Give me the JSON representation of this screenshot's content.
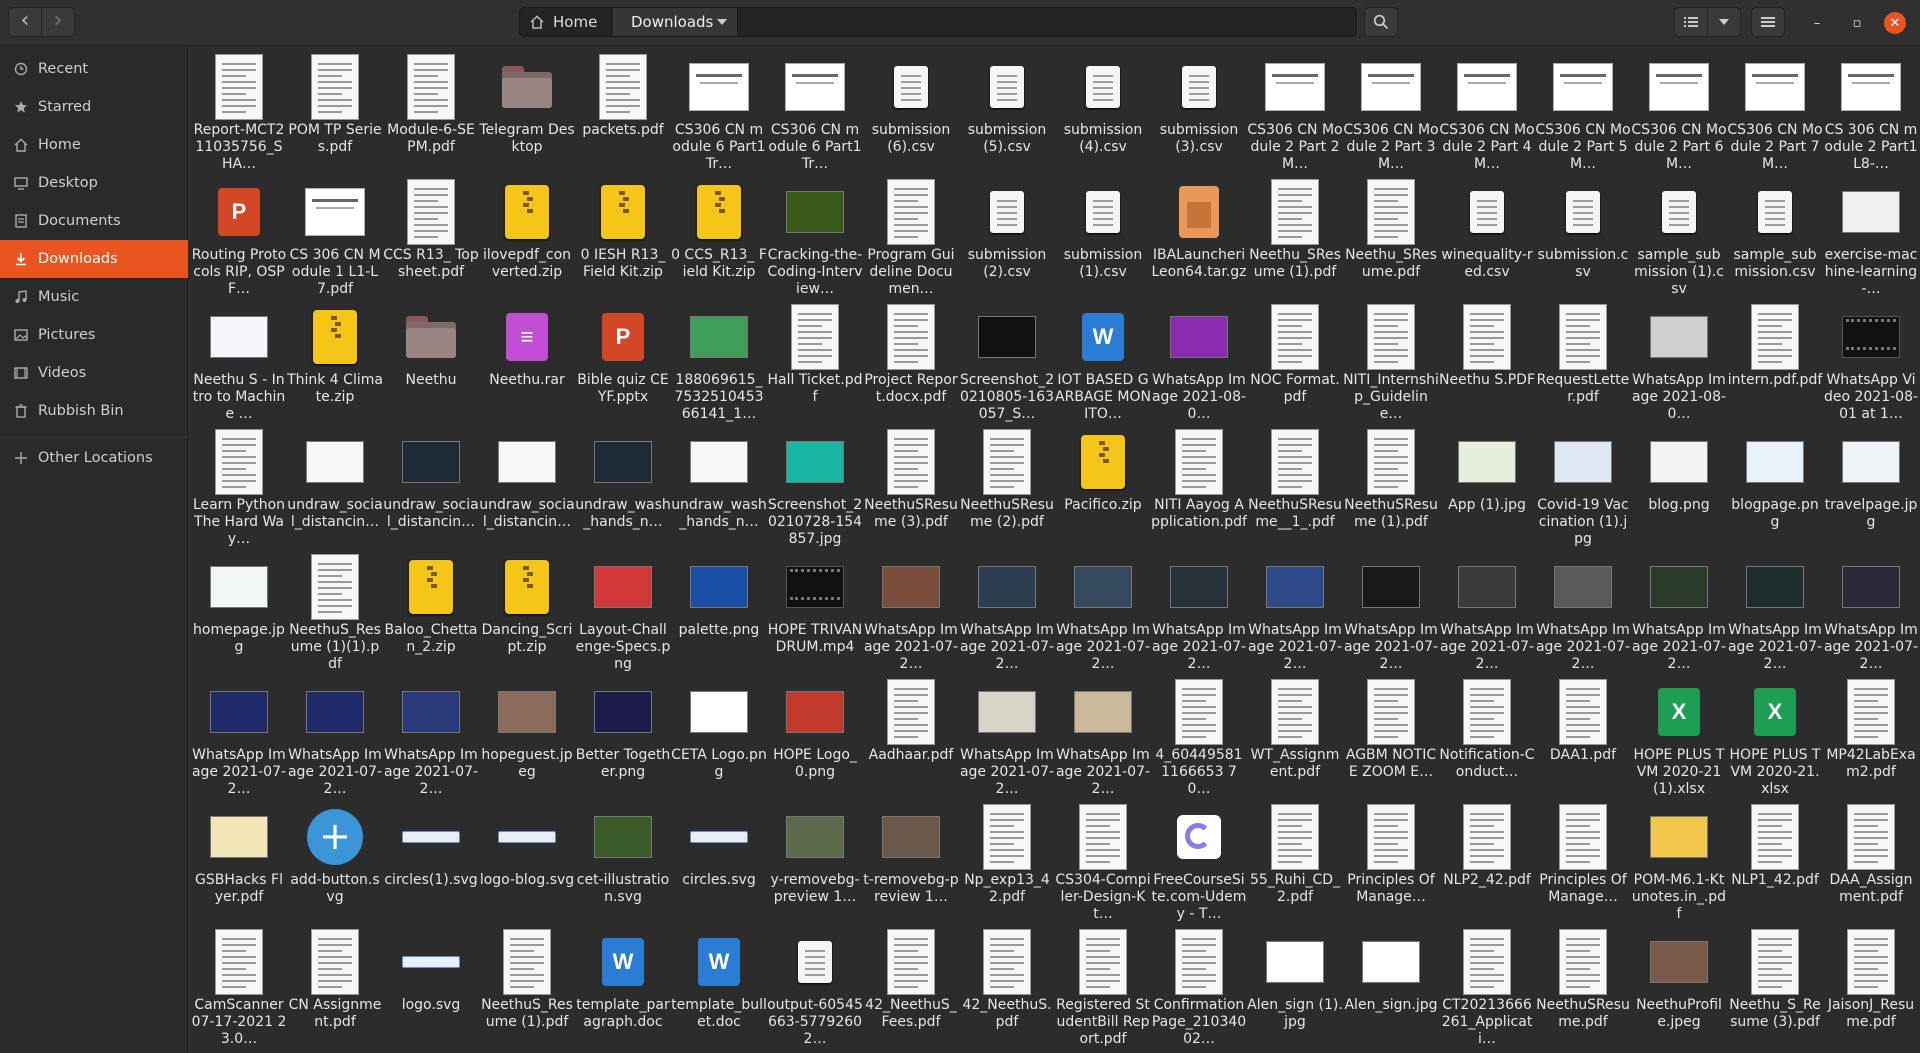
{
  "header": {
    "back_icon": "chevron-left-icon",
    "forward_icon": "chevron-right-icon",
    "crumb_home": "Home",
    "crumb_current": "Downloads",
    "search_icon": "search-icon",
    "view_icon": "list-view-icon",
    "menu_icon": "hamburger-menu-icon",
    "window_controls": [
      "minimize-icon",
      "maximize-icon",
      "close-icon"
    ],
    "accent_color": "#e95420"
  },
  "sidebar": {
    "items": [
      {
        "label": "Recent",
        "icon": "clock-icon",
        "active": false
      },
      {
        "label": "Starred",
        "icon": "star-icon",
        "active": false
      },
      {
        "label": "Home",
        "icon": "home-icon",
        "active": false
      },
      {
        "label": "Desktop",
        "icon": "desktop-icon",
        "active": false
      },
      {
        "label": "Documents",
        "icon": "documents-icon",
        "active": false
      },
      {
        "label": "Downloads",
        "icon": "download-icon",
        "active": true
      },
      {
        "label": "Music",
        "icon": "music-icon",
        "active": false
      },
      {
        "label": "Pictures",
        "icon": "pictures-icon",
        "active": false
      },
      {
        "label": "Videos",
        "icon": "videos-icon",
        "active": false
      },
      {
        "label": "Rubbish Bin",
        "icon": "trash-icon",
        "active": false
      },
      {
        "label": "Other Locations",
        "icon": "plus-icon",
        "active": false
      }
    ]
  },
  "files": [
    {
      "name": "Report-MCT211035756_SHA…",
      "kind": "doc"
    },
    {
      "name": "POM TP Series.pdf",
      "kind": "doc"
    },
    {
      "name": "Module-6-SEPM.pdf",
      "kind": "doc"
    },
    {
      "name": "Telegram Desktop",
      "kind": "folder"
    },
    {
      "name": "packets.pdf",
      "kind": "doc"
    },
    {
      "name": "CS306 CN module 6 Part1 Tr…",
      "kind": "slide"
    },
    {
      "name": "CS306 CN module 6 Part1 Tr…",
      "kind": "slide"
    },
    {
      "name": "submission (6).csv",
      "kind": "gen"
    },
    {
      "name": "submission (5).csv",
      "kind": "gen"
    },
    {
      "name": "submission (4).csv",
      "kind": "gen"
    },
    {
      "name": "submission (3).csv",
      "kind": "gen"
    },
    {
      "name": "CS306 CN Module 2 Part 2 M…",
      "kind": "slide"
    },
    {
      "name": "CS306 CN Module 2 Part 3 M…",
      "kind": "slide"
    },
    {
      "name": "CS306 CN Module 2 Part 4 M…",
      "kind": "slide"
    },
    {
      "name": "CS306 CN Module 2 Part 5 M…",
      "kind": "slide"
    },
    {
      "name": "CS306 CN Module 2 Part 6 M…",
      "kind": "slide"
    },
    {
      "name": "CS306 CN Module 2 Part 7 M…",
      "kind": "slide"
    },
    {
      "name": "CS 306 CN module 2 Part1 L8-…",
      "kind": "slide"
    },
    {
      "name": "Routing Protocols RIP, OSPF…",
      "kind": "ppt"
    },
    {
      "name": "CS 306 CN Module 1 L1-L7.pdf",
      "kind": "slide"
    },
    {
      "name": "CCS R13_ Topsheet.pdf",
      "kind": "doc"
    },
    {
      "name": "ilovepdf_converted.zip",
      "kind": "zip"
    },
    {
      "name": "0 IESH R13_ Field Kit.zip",
      "kind": "zip"
    },
    {
      "name": "0 CCS_R13_ Field Kit.zip",
      "kind": "zip"
    },
    {
      "name": "Cracking-the-Coding-Interview…",
      "kind": "img",
      "color": "#3a5a1a"
    },
    {
      "name": "Program Guideline Documen…",
      "kind": "doc"
    },
    {
      "name": "submission (2).csv",
      "kind": "gen"
    },
    {
      "name": "submission (1).csv",
      "kind": "gen"
    },
    {
      "name": "IBALauncheriLeon64.tar.gz",
      "kind": "tar"
    },
    {
      "name": "Neethu_SResume (1).pdf",
      "kind": "doc"
    },
    {
      "name": "Neethu_SResume.pdf",
      "kind": "doc"
    },
    {
      "name": "winequality-red.csv",
      "kind": "gen"
    },
    {
      "name": "submission.csv",
      "kind": "gen"
    },
    {
      "name": "sample_submission (1).csv",
      "kind": "gen"
    },
    {
      "name": "sample_submission.csv",
      "kind": "gen"
    },
    {
      "name": "exercise-machine-learning-…",
      "kind": "img",
      "color": "#f0f0f0"
    },
    {
      "name": "Neethu S - Intro to Machine …",
      "kind": "img",
      "color": "#f4f6fb"
    },
    {
      "name": "Think 4 Climate.zip",
      "kind": "zip"
    },
    {
      "name": "Neethu",
      "kind": "folder"
    },
    {
      "name": "Neethu.rar",
      "kind": "rar"
    },
    {
      "name": "Bible quiz CEYF.pptx",
      "kind": "ppt"
    },
    {
      "name": "188069615_753251045366141_1…",
      "kind": "img",
      "color": "#3f9f5a"
    },
    {
      "name": "Hall Ticket.pdf",
      "kind": "doc"
    },
    {
      "name": "Project Report.docx.pdf",
      "kind": "doc"
    },
    {
      "name": "Screenshot_20210805-163057_S…",
      "kind": "img",
      "color": "#111111"
    },
    {
      "name": "IOT BASED GARBAGE MONITO…",
      "kind": "word"
    },
    {
      "name": "WhatsApp Image 2021-08-0…",
      "kind": "img",
      "color": "#8a2bb0"
    },
    {
      "name": "NOC Format.pdf",
      "kind": "doc"
    },
    {
      "name": "NITI_Internship_Guideline…",
      "kind": "doc"
    },
    {
      "name": "Neethu S.PDF",
      "kind": "doc"
    },
    {
      "name": "RequestLetter.pdf",
      "kind": "doc"
    },
    {
      "name": "WhatsApp Image 2021-08-0…",
      "kind": "img",
      "color": "#cfcfcf"
    },
    {
      "name": "intern.pdf.pdf",
      "kind": "doc"
    },
    {
      "name": "WhatsApp Video 2021-08-01 at 1…",
      "kind": "video"
    },
    {
      "name": "Learn Python The Hard Way…",
      "kind": "doc"
    },
    {
      "name": "undraw_social_distancin…",
      "kind": "img",
      "color": "#f7f7f7"
    },
    {
      "name": "undraw_social_distancin…",
      "kind": "img",
      "color": "#1e2a38"
    },
    {
      "name": "undraw_social_distancin…",
      "kind": "img",
      "color": "#f7f7f7"
    },
    {
      "name": "undraw_wash_hands_n…",
      "kind": "img",
      "color": "#1e2a38"
    },
    {
      "name": "undraw_wash_hands_n…",
      "kind": "img",
      "color": "#f7f7f7"
    },
    {
      "name": "Screenshot_20210728-154857.jpg",
      "kind": "img",
      "color": "#19b6a4"
    },
    {
      "name": "NeethuSResume (3).pdf",
      "kind": "doc"
    },
    {
      "name": "NeethuSResume (2).pdf",
      "kind": "doc"
    },
    {
      "name": "Pacifico.zip",
      "kind": "zip"
    },
    {
      "name": "NITI Aayog Application.pdf",
      "kind": "doc"
    },
    {
      "name": "NeethuSResume__1_.pdf",
      "kind": "doc"
    },
    {
      "name": "NeethuSResume (1).pdf",
      "kind": "doc"
    },
    {
      "name": "App (1).jpg",
      "kind": "img",
      "color": "#e5efd9"
    },
    {
      "name": "Covid-19 Vaccination (1).jpg",
      "kind": "img",
      "color": "#dfe7f3"
    },
    {
      "name": "blog.png",
      "kind": "img",
      "color": "#f3f3f3"
    },
    {
      "name": "blogpage.png",
      "kind": "img",
      "color": "#e9f1f9"
    },
    {
      "name": "travelpage.jpg",
      "kind": "img",
      "color": "#eef3f7"
    },
    {
      "name": "homepage.jpg",
      "kind": "img",
      "color": "#f3f6f6"
    },
    {
      "name": "NeethuS_Resume (1)(1).pdf",
      "kind": "doc"
    },
    {
      "name": "Baloo_Chettan_2.zip",
      "kind": "zip"
    },
    {
      "name": "Dancing_Script.zip",
      "kind": "zip"
    },
    {
      "name": "Layout-Challenge-Specs.png",
      "kind": "img",
      "color": "#d33838"
    },
    {
      "name": "palette.png",
      "kind": "img",
      "color": "#1b4fa8"
    },
    {
      "name": "HOPE TRIVANDRUM.mp4",
      "kind": "video"
    },
    {
      "name": "WhatsApp Image 2021-07-2…",
      "kind": "img",
      "color": "#7a4c3c"
    },
    {
      "name": "WhatsApp Image 2021-07-2…",
      "kind": "img",
      "color": "#2c3e50"
    },
    {
      "name": "WhatsApp Image 2021-07-2…",
      "kind": "img",
      "color": "#34495e"
    },
    {
      "name": "WhatsApp Image 2021-07-2…",
      "kind": "img",
      "color": "#263238"
    },
    {
      "name": "WhatsApp Image 2021-07-2…",
      "kind": "img",
      "color": "#2e4a8a"
    },
    {
      "name": "WhatsApp Image 2021-07-2…",
      "kind": "img",
      "color": "#1a1a1a"
    },
    {
      "name": "WhatsApp Image 2021-07-2…",
      "kind": "img",
      "color": "#3b3b3b"
    },
    {
      "name": "WhatsApp Image 2021-07-2…",
      "kind": "img",
      "color": "#5a5a5a"
    },
    {
      "name": "WhatsApp Image 2021-07-2…",
      "kind": "img",
      "color": "#2a3a2a"
    },
    {
      "name": "WhatsApp Image 2021-07-2…",
      "kind": "img",
      "color": "#1e2e2e"
    },
    {
      "name": "WhatsApp Image 2021-07-2…",
      "kind": "img",
      "color": "#2a2a3a"
    },
    {
      "name": "WhatsApp Image 2021-07-2…",
      "kind": "img",
      "color": "#1e2a6a"
    },
    {
      "name": "WhatsApp Image 2021-07-2…",
      "kind": "img",
      "color": "#1e2a6a"
    },
    {
      "name": "WhatsApp Image 2021-07-2…",
      "kind": "img",
      "color": "#2a3a7a"
    },
    {
      "name": "hopeguest.jpeg",
      "kind": "img",
      "color": "#8a6a5a"
    },
    {
      "name": "Better Together.png",
      "kind": "img",
      "color": "#1e1a4a"
    },
    {
      "name": "CETA Logo.png",
      "kind": "img",
      "color": "#ffffff"
    },
    {
      "name": "HOPE Logo_0.png",
      "kind": "img",
      "color": "#c0392b"
    },
    {
      "name": "Aadhaar.pdf",
      "kind": "doc"
    },
    {
      "name": "WhatsApp Image 2021-07-2…",
      "kind": "img",
      "color": "#d9d4c8"
    },
    {
      "name": "WhatsApp Image 2021-07-2…",
      "kind": "img",
      "color": "#c9b89a"
    },
    {
      "name": "4_604495811166653 70…",
      "kind": "doc"
    },
    {
      "name": "WT_Assignment.pdf",
      "kind": "doc"
    },
    {
      "name": "AGBM NOTICE ZOOM E…",
      "kind": "doc"
    },
    {
      "name": "Notification-Conduct…",
      "kind": "doc"
    },
    {
      "name": "DAA1.pdf",
      "kind": "doc"
    },
    {
      "name": "HOPE PLUS TVM 2020-21 (1).xlsx",
      "kind": "xls"
    },
    {
      "name": "HOPE PLUS TVM 2020-21.xlsx",
      "kind": "xls"
    },
    {
      "name": "MP42LabExam2.pdf",
      "kind": "doc"
    },
    {
      "name": "GSBHacks Flyer.pdf",
      "kind": "img",
      "color": "#f2e6b8"
    },
    {
      "name": "add-button.svg",
      "kind": "plus"
    },
    {
      "name": "circles(1).svg",
      "kind": "svgbar"
    },
    {
      "name": "logo-blog.svg",
      "kind": "svgbar"
    },
    {
      "name": "cet-illustration.svg",
      "kind": "img",
      "color": "#3a5a2a"
    },
    {
      "name": "circles.svg",
      "kind": "svgbar"
    },
    {
      "name": "y-removebg-preview 1…",
      "kind": "img",
      "color": "#5d6b4c"
    },
    {
      "name": "t-removebg-preview 1…",
      "kind": "img",
      "color": "#6b5a4c"
    },
    {
      "name": "Np_exp13_42.pdf",
      "kind": "doc"
    },
    {
      "name": "CS304-Compiler-Design-Kt…",
      "kind": "doc"
    },
    {
      "name": "FreeCourseSite.com-Udemy - T…",
      "kind": "fc"
    },
    {
      "name": "55_Ruhi_CD_2.pdf",
      "kind": "doc"
    },
    {
      "name": "Principles Of Manage…",
      "kind": "doc"
    },
    {
      "name": "NLP2_42.pdf",
      "kind": "doc"
    },
    {
      "name": "Principles Of Manage…",
      "kind": "doc"
    },
    {
      "name": "POM-M6.1-Ktunotes.in_.pdf",
      "kind": "img",
      "color": "#f2c94c"
    },
    {
      "name": "NLP1_42.pdf",
      "kind": "doc"
    },
    {
      "name": "DAA_Assignment.pdf",
      "kind": "doc"
    },
    {
      "name": "CamScanner 07-17-2021 23.0…",
      "kind": "doc"
    },
    {
      "name": "CN Assignment.pdf",
      "kind": "doc"
    },
    {
      "name": "logo.svg",
      "kind": "svgbar"
    },
    {
      "name": "NeethuS_Resume (1).pdf",
      "kind": "doc"
    },
    {
      "name": "template_paragraph.doc",
      "kind": "word"
    },
    {
      "name": "template_bullet.doc",
      "kind": "word"
    },
    {
      "name": "output-60545663-57792602…",
      "kind": "gen"
    },
    {
      "name": "42_NeethuS_Fees.pdf",
      "kind": "doc"
    },
    {
      "name": "42_NeethuS.pdf",
      "kind": "doc"
    },
    {
      "name": "Registered StudentBill Report.pdf",
      "kind": "doc"
    },
    {
      "name": "ConfirmationPage_21034002…",
      "kind": "doc"
    },
    {
      "name": "Alen_sign (1).jpg",
      "kind": "img",
      "color": "#ffffff"
    },
    {
      "name": "Alen_sign.jpg",
      "kind": "img",
      "color": "#ffffff"
    },
    {
      "name": "CT20213666261_Applicati…",
      "kind": "doc"
    },
    {
      "name": "NeethuSResume.pdf",
      "kind": "doc"
    },
    {
      "name": "NeethuProfile.jpeg",
      "kind": "img",
      "color": "#7a5a4a"
    },
    {
      "name": "Neethu_S_Resume (3).pdf",
      "kind": "doc"
    },
    {
      "name": "JaisonJ_Resume.pdf",
      "kind": "doc"
    }
  ]
}
